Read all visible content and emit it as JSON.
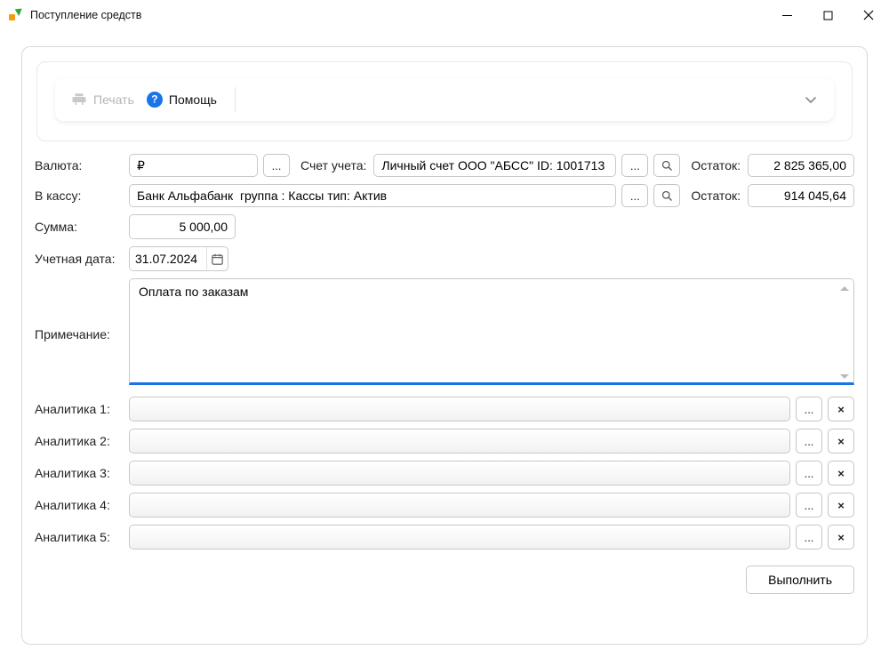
{
  "window": {
    "title": "Поступление средств"
  },
  "toolbar": {
    "print": "Печать",
    "help": "Помощь"
  },
  "labels": {
    "currency": "Валюта:",
    "account": "Счет учета:",
    "balance": "Остаток:",
    "to_cash": "В кассу:",
    "amount": "Сумма:",
    "date": "Учетная дата:",
    "note": "Примечание:"
  },
  "fields": {
    "currency": "₽",
    "account": "Личный счет ООО \"АБСС\" ID: 1001713",
    "account_balance": "2 825 365,00",
    "cashbox": "Банк Альфабанк  группа : Кассы тип: Актив",
    "cashbox_balance": "914 045,64",
    "amount": "5 000,00",
    "date": "31.07.2024",
    "note": "Оплата по заказам"
  },
  "analytics": [
    {
      "label": "Аналитика 1:"
    },
    {
      "label": "Аналитика 2:"
    },
    {
      "label": "Аналитика 3:"
    },
    {
      "label": "Аналитика 4:"
    },
    {
      "label": "Аналитика 5:"
    }
  ],
  "actions": {
    "execute": "Выполнить"
  }
}
